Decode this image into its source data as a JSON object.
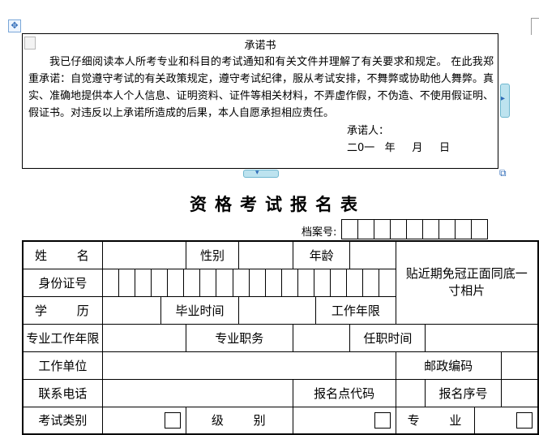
{
  "pledge": {
    "title": "承诺书",
    "body": "我已仔细阅读本人所考专业和科目的考试通知和有关文件并理解了有关要求和规定。 在此我郑重承诺：自觉遵守考试的有关政策规定，遵守考试纪律，服从考试安排，不舞弊或协助他人舞弊。真实、准确地提供本人个人信息、证明资料、证件等相关材料，不弄虚作假，不伪造、不使用假证明、假证书。对违反以上承诺所造成的后果，本人自愿承担相应责任。",
    "signer_label": "承诺人：",
    "date_label": "二0一   年     月     日"
  },
  "form": {
    "title": "资格考试报名表",
    "archive_label": "档案号:",
    "archive_box_count": 9,
    "id_box_count": 18,
    "labels": {
      "name": "姓 名",
      "gender": "性别",
      "age": "年龄",
      "id_number": "身份证号",
      "photo": "贴近期免冠正面同底一寸相片",
      "education": "学 历",
      "graduation_time": "毕业时间",
      "work_years": "工作年限",
      "professional_years": "专业工作年限",
      "professional_title": "专业职务",
      "appointment_time": "任职时间",
      "work_unit": "工作单位",
      "postal_code": "邮政编码",
      "phone": "联系电话",
      "exam_site_code": "报名点代码",
      "registration_number": "报名序号",
      "exam_category": "考试类别",
      "level": "级 别",
      "major": "专 业"
    }
  }
}
